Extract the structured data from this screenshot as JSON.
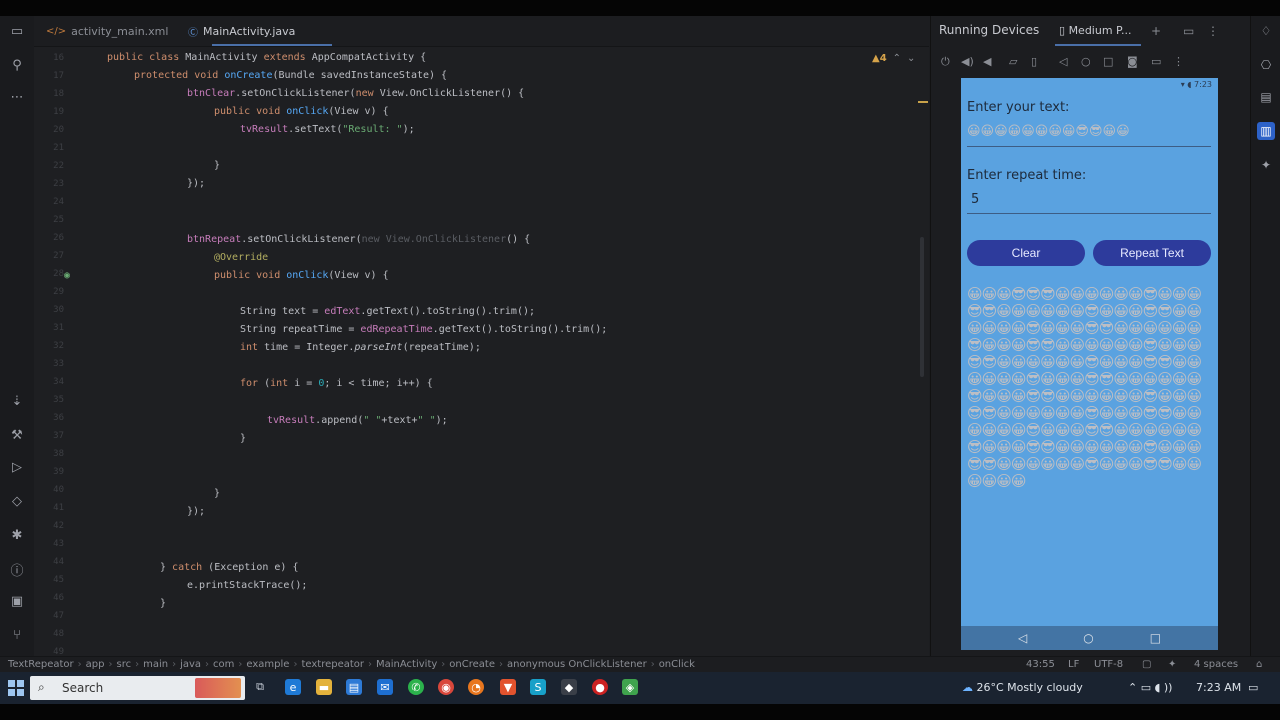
{
  "tabs": {
    "file1": "activity_main.xml",
    "file2": "MainActivity.java",
    "warnings": "▲4"
  },
  "running_devices": {
    "title": "Running Devices",
    "device_tab": "Medium P..."
  },
  "code": {
    "line_numbers": [
      "16",
      "17",
      "18",
      "19",
      "20",
      "21",
      "22",
      "23",
      "24",
      "25",
      "26",
      "27",
      "28",
      "29",
      "30",
      "31",
      "32",
      "33",
      "34",
      "35",
      "36",
      "37",
      "38",
      "39",
      "40",
      "41",
      "42",
      "43",
      "44",
      "45",
      "46",
      "47",
      "48",
      "49"
    ],
    "l1a": "public class ",
    "l1b": "MainActivity ",
    "l1c": "extends ",
    "l1d": "AppCompatActivity {",
    "l2a": "protected void ",
    "l2b": "onCreate",
    "l2c": "(Bundle savedInstanceState) {",
    "l3a": "btnClear",
    "l3b": ".setOnClickListener(",
    "l3c": "new ",
    "l3d": "View.OnClickListener() {",
    "l4a": "public void ",
    "l4b": "onClick",
    "l4c": "(View v) {",
    "l5a": "tvResult",
    "l5b": ".setText(",
    "l5c": "\"Result: \"",
    "l5d": ");",
    "l6": "}",
    "l7": "});",
    "l8a": "btnRepeat",
    "l8b": ".setOnClickListener(",
    "l8c": "new View.OnClickListener",
    "l8d": "() {",
    "l9": "@Override",
    "l10a": "public void ",
    "l10b": "onClick",
    "l10c": "(View v) {",
    "l11a": "String text = ",
    "l11b": "edText",
    "l11c": ".getText().toString().trim();",
    "l12a": "String repeatTime = ",
    "l12b": "edRepeatTime",
    "l12c": ".getText().toString().trim();",
    "l13a": "int ",
    "l13b": "time = Integer.",
    "l13c": "parseInt",
    "l13d": "(repeatTime);",
    "l14a": "for ",
    "l14b": "(",
    "l14c": "int ",
    "l14d": "i = ",
    "l14e": "0",
    "l14f": "; i < time; i++) {",
    "l15a": "tvResult",
    "l15b": ".append(",
    "l15c": "\" \"",
    "l15d": "+text+",
    "l15e": "\" \"",
    "l15f": ");",
    "l16": "}",
    "l17": "}",
    "l18": "});",
    "l19a": "} ",
    "l19b": "catch ",
    "l19c": "(Exception e) {",
    "l20": "e.printStackTrace();",
    "l21": "}"
  },
  "phone": {
    "status": "▾ ◖ 7:23",
    "label_text": "Enter your text:",
    "input_text": "😀😀😀😀😀😀😀😀😎😎😀😀",
    "label_repeat": "Enter repeat time:",
    "input_repeat": "5",
    "btn_clear": "Clear",
    "btn_repeat": "Repeat Text",
    "result": "😀😀😀😎😎😎😀😀😀😀😀😀😎😀😀😀😎😎😀😀😀😀😀😀😎😀😀😀😎😎😀😀😀😀😀😀😎😀😀😀😎😎😀😀😀😀😀😀😎😀😀😀😎😎😀😀😀😀😀😀😎😀😀😀😎😎😀😀😀😀😀😀😎😀😀😀😎😎😀😀😀😀😀😀😎😀😀😀😎😎😀😀😀😀😀😀😎😀😀😀😎😎😀😀😀😀😀😀😎😀😀😀😎😎😀😀😀😀😀😀😎😀😀😀😎😎😀😀😀😀😀😀😎😀😀😀😎😎😀😀😀😀😀😀😎😀😀😀😎😎😀😀😀😀😀😀😎😀😀😀😎😎😀😀😀😀😀😀😎😀😀😀😎😎😀😀😀😀😀😀"
  },
  "breadcrumb": [
    "TextRepeator",
    "app",
    "src",
    "main",
    "java",
    "com",
    "example",
    "textrepeator",
    "MainActivity",
    "onCreate",
    "anonymous OnClickListener",
    "onClick"
  ],
  "status_right": {
    "pos": "43:55",
    "lf": "LF",
    "enc": "UTF-8",
    "indent": "4 spaces"
  },
  "taskbar": {
    "search": "Search",
    "weather": "26°C  Mostly cloudy",
    "time": "7:23 AM"
  },
  "colors": {
    "accent": "#4a6fa8",
    "phone_bg": "#5aa2e0",
    "button": "#2d3b9c"
  }
}
